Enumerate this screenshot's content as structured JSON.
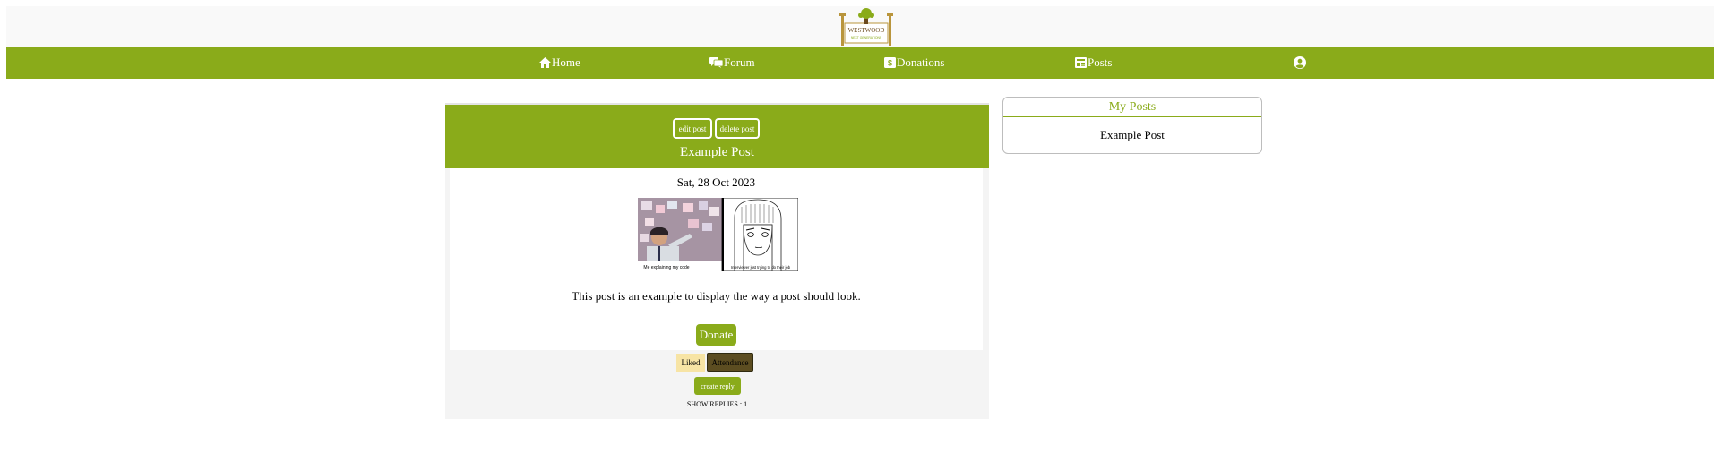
{
  "brand": {
    "logo_line1": "WESTWOOD",
    "logo_line2": "NEXT GENERATIONS"
  },
  "nav": {
    "items": [
      {
        "label": "Home",
        "icon": "home-icon"
      },
      {
        "label": "Forum",
        "icon": "chat-bubbles-icon"
      },
      {
        "label": "Donations",
        "icon": "dollar-bill-icon"
      },
      {
        "label": "Posts",
        "icon": "newspaper-icon"
      }
    ],
    "account_icon": "user-circle-icon"
  },
  "colors": {
    "accent": "#8aab1a",
    "liked": "#f7e4a5",
    "attendance": "#5c4d21"
  },
  "post": {
    "edit_label": "edit post",
    "delete_label": "delete post",
    "title": "Example Post",
    "date": "Sat, 28 Oct 2023",
    "image_caption_left": "Me explaining my code",
    "image_caption_right": "Interviewer just trying to do their job",
    "text": "This post is an example to display the way a post should look.",
    "donate_label": "Donate",
    "liked_label": "Liked",
    "attendance_label": "Attendance",
    "reply_label": "create reply",
    "show_replies_label": "SHOW REPLIES : 1"
  },
  "sidebar": {
    "title": "My Posts",
    "items": [
      "Example Post"
    ]
  }
}
